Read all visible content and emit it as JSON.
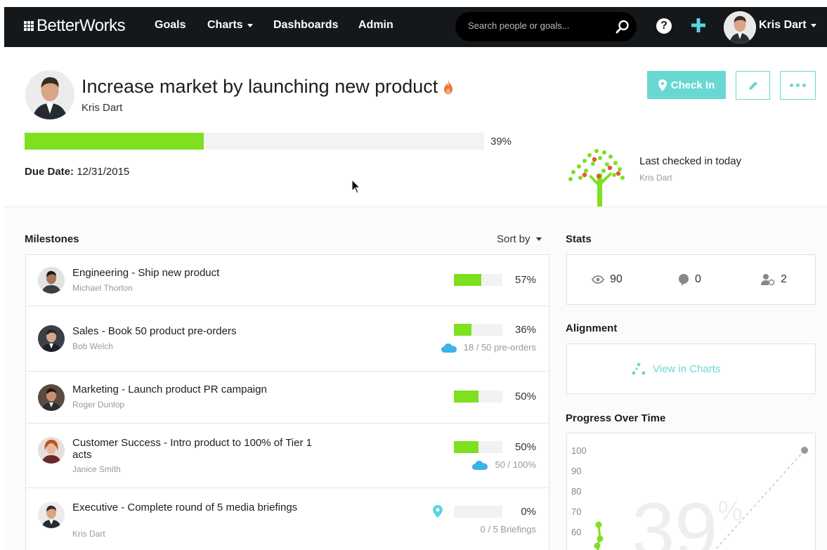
{
  "topbar": {
    "logo": "BetterWorks",
    "nav": [
      {
        "label": "Goals"
      },
      {
        "label": "Charts",
        "dropdown": true
      },
      {
        "label": "Dashboards"
      },
      {
        "label": "Admin"
      }
    ],
    "search_placeholder": "Search people or goals...",
    "user_name": "Kris Dart"
  },
  "goal": {
    "title": "Increase market by launching new product",
    "owner": "Kris Dart",
    "progress": 39,
    "progress_label": "39%",
    "due_label": "Due Date:",
    "due_date": "12/31/2015",
    "last_checked": "Last checked in today",
    "last_checked_by": "Kris Dart",
    "checkin_label": "Check In"
  },
  "milestones": {
    "title": "Milestones",
    "sort_label": "Sort by",
    "items": [
      {
        "title": "Engineering - Ship new product",
        "owner": "Michael Thorton",
        "progress": 57,
        "pct": "57%",
        "sub": ""
      },
      {
        "title": "Sales - Book 50 product pre-orders",
        "owner": "Bob Welch",
        "progress": 36,
        "pct": "36%",
        "sub": "18 / 50 pre-orders"
      },
      {
        "title": "Marketing - Launch product PR campaign",
        "owner": "Roger Dunlop",
        "progress": 50,
        "pct": "50%",
        "sub": ""
      },
      {
        "title": "Customer Success - Intro product to 100% of Tier 1 acts",
        "owner": "Janice Smith",
        "progress": 50,
        "pct": "50%",
        "sub": "50 / 100%"
      },
      {
        "title": "Executive - Complete round of 5 media briefings",
        "owner": "Kris Dart",
        "progress": 0,
        "pct": "0%",
        "sub": "0 / 5 Briefings"
      }
    ]
  },
  "stats": {
    "title": "Stats",
    "views": "90",
    "comments": "0",
    "followers": "2"
  },
  "alignment": {
    "title": "Alignment",
    "link": "View in Charts"
  },
  "progress_chart": {
    "title": "Progress Over Time",
    "y_ticks": [
      "100",
      "90",
      "80",
      "70",
      "60"
    ],
    "big_label": "39",
    "big_suffix": "%"
  },
  "colors": {
    "accent": "#69d8d3",
    "progress": "#7ee01e",
    "topbar": "#15181b"
  }
}
